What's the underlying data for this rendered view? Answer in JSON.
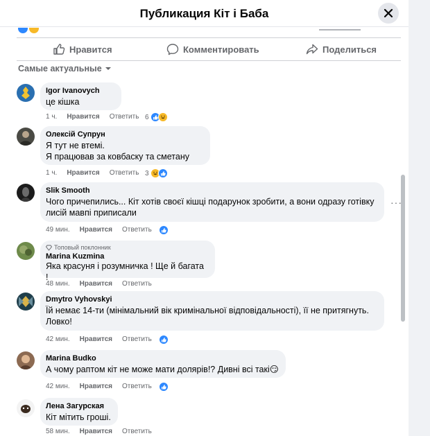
{
  "header": {
    "title": "Публикация Кіт і Баба"
  },
  "actions": {
    "like": "Нравится",
    "comment": "Комментировать",
    "share": "Поделиться"
  },
  "sort": {
    "label": "Самые актуальные"
  },
  "comments": [
    {
      "name": "Igor Ivanovych",
      "text": [
        "це кішка"
      ],
      "time": "1 ч.",
      "like": "Нравится",
      "reply": "Ответить",
      "reactions_count": "6",
      "reactions": [
        "like",
        "haha"
      ]
    },
    {
      "name": "Олексій Супрун",
      "text": [
        "Я тут не втемі.",
        "Я працював за ковбаску та сметану"
      ],
      "time": "1 ч.",
      "like": "Нравится",
      "reply": "Ответить",
      "reactions_count": "3",
      "reactions": [
        "haha",
        "like"
      ]
    },
    {
      "name": "Slik Smooth",
      "text": [
        "Чого причепились... Кіт хотів своєї кішці подарунок зробити, а вони одразу готівку",
        "лисій мавпі приписали"
      ],
      "time": "49 мин.",
      "like": "Нравится",
      "reply": "Ответить",
      "reactions": [
        "like"
      ]
    },
    {
      "badge": "Топовый поклонник",
      "name": "Marina Kuzmina",
      "text": [
        "Яка красуня і розумничка ! Ще й багата !"
      ],
      "time": "48 мин.",
      "like": "Нравится",
      "reply": "Ответить"
    },
    {
      "name": "Dmytro Vyhovskyi",
      "text": [
        "Їй немає 14-ти (мінімальний вік кримінальної відповідальності), її не притягнуть.",
        "Ловко!"
      ],
      "time": "42 мин.",
      "like": "Нравится",
      "reply": "Ответить",
      "reactions": [
        "like"
      ]
    },
    {
      "name": "Marina Budko",
      "text": [
        "А чому раптом кіт не може мати долярів!? Дивні всі такі😏"
      ],
      "time": "42 мин.",
      "like": "Нравится",
      "reply": "Ответить",
      "reactions": [
        "like"
      ]
    },
    {
      "name": "Лена Загурская",
      "text": [
        "Кіт мітить гроші."
      ],
      "time": "58 мин.",
      "like": "Нравится",
      "reply": "Ответить"
    }
  ],
  "icons": {
    "close": "close-icon",
    "like": "thumbs-up-icon",
    "comment": "speech-bubble-icon",
    "share": "share-arrow-icon",
    "dropdown": "caret-down-icon",
    "badge": "diamond-icon",
    "more": "ellipsis-icon"
  },
  "colors": {
    "accent": "#2d88ff",
    "haha": "#f7b928",
    "bubble": "#f0f2f5",
    "secondary_text": "#65676b"
  }
}
